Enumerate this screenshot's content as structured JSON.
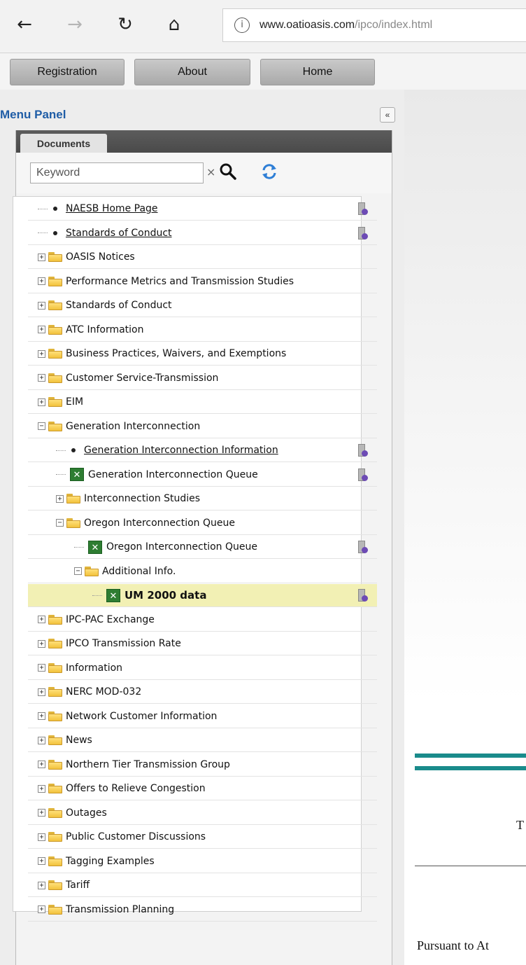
{
  "browser": {
    "url_host": "www.oatioasis.com",
    "url_path": "/ipco/index.html",
    "back_glyph": "←",
    "forward_glyph": "→",
    "refresh_glyph": "↻",
    "home_glyph": "⌂",
    "info_glyph": "i"
  },
  "topnav": {
    "registration": "Registration",
    "about": "About",
    "home": "Home"
  },
  "menu": {
    "title": "Menu Panel",
    "collapse_glyph": "«",
    "tab": "Documents",
    "keyword_placeholder": "Keyword",
    "clear_glyph": "×"
  },
  "tree": [
    {
      "label": "NAESB Home Page",
      "type": "link",
      "indent": 0,
      "clip": true
    },
    {
      "label": "Standards of Conduct",
      "type": "link",
      "indent": 0,
      "clip": true
    },
    {
      "label": "OASIS Notices",
      "type": "folder",
      "indent": 0,
      "expanded": false
    },
    {
      "label": "Performance Metrics and Transmission Studies",
      "type": "folder",
      "indent": 0,
      "expanded": false
    },
    {
      "label": "Standards of Conduct",
      "type": "folder",
      "indent": 0,
      "expanded": false
    },
    {
      "label": "ATC Information",
      "type": "folder",
      "indent": 0,
      "expanded": false
    },
    {
      "label": "Business Practices, Waivers, and Exemptions",
      "type": "folder",
      "indent": 0,
      "expanded": false
    },
    {
      "label": "Customer Service-Transmission",
      "type": "folder",
      "indent": 0,
      "expanded": false
    },
    {
      "label": "EIM",
      "type": "folder",
      "indent": 0,
      "expanded": false
    },
    {
      "label": "Generation Interconnection",
      "type": "folder",
      "indent": 0,
      "expanded": true
    },
    {
      "label": "Generation Interconnection Information",
      "type": "link",
      "indent": 1,
      "clip": true
    },
    {
      "label": "Generation Interconnection Queue",
      "type": "xls",
      "indent": 1,
      "clip": true
    },
    {
      "label": "Interconnection Studies",
      "type": "folder",
      "indent": 1,
      "expanded": false
    },
    {
      "label": "Oregon Interconnection Queue",
      "type": "folder",
      "indent": 1,
      "expanded": true
    },
    {
      "label": "Oregon Interconnection Queue",
      "type": "xls",
      "indent": 2,
      "clip": true
    },
    {
      "label": "Additional Info.",
      "type": "folder",
      "indent": 2,
      "expanded": true
    },
    {
      "label": "UM 2000 data",
      "type": "xls",
      "indent": 3,
      "clip": true,
      "selected": true
    },
    {
      "label": "IPC-PAC Exchange",
      "type": "folder",
      "indent": 0,
      "expanded": false
    },
    {
      "label": "IPCO Transmission Rate",
      "type": "folder",
      "indent": 0,
      "expanded": false
    },
    {
      "label": "Information",
      "type": "folder",
      "indent": 0,
      "expanded": false
    },
    {
      "label": "NERC MOD-032",
      "type": "folder",
      "indent": 0,
      "expanded": false
    },
    {
      "label": "Network Customer Information",
      "type": "folder",
      "indent": 0,
      "expanded": false
    },
    {
      "label": "News",
      "type": "folder",
      "indent": 0,
      "expanded": false
    },
    {
      "label": "Northern Tier Transmission Group",
      "type": "folder",
      "indent": 0,
      "expanded": false
    },
    {
      "label": "Offers to Relieve Congestion",
      "type": "folder",
      "indent": 0,
      "expanded": false
    },
    {
      "label": "Outages",
      "type": "folder",
      "indent": 0,
      "expanded": false
    },
    {
      "label": "Public Customer Discussions",
      "type": "folder",
      "indent": 0,
      "expanded": false
    },
    {
      "label": "Tagging Examples",
      "type": "folder",
      "indent": 0,
      "expanded": false
    },
    {
      "label": "Tariff",
      "type": "folder",
      "indent": 0,
      "expanded": false
    },
    {
      "label": "Transmission Planning",
      "type": "folder",
      "indent": 0,
      "expanded": false
    }
  ],
  "content": {
    "letter_t": "T",
    "pursuant": "Pursuant to At"
  },
  "colors": {
    "menu_title": "#1f5da6",
    "selected_row": "#f2f0b4",
    "teal_rule": "#1a8b8b"
  }
}
